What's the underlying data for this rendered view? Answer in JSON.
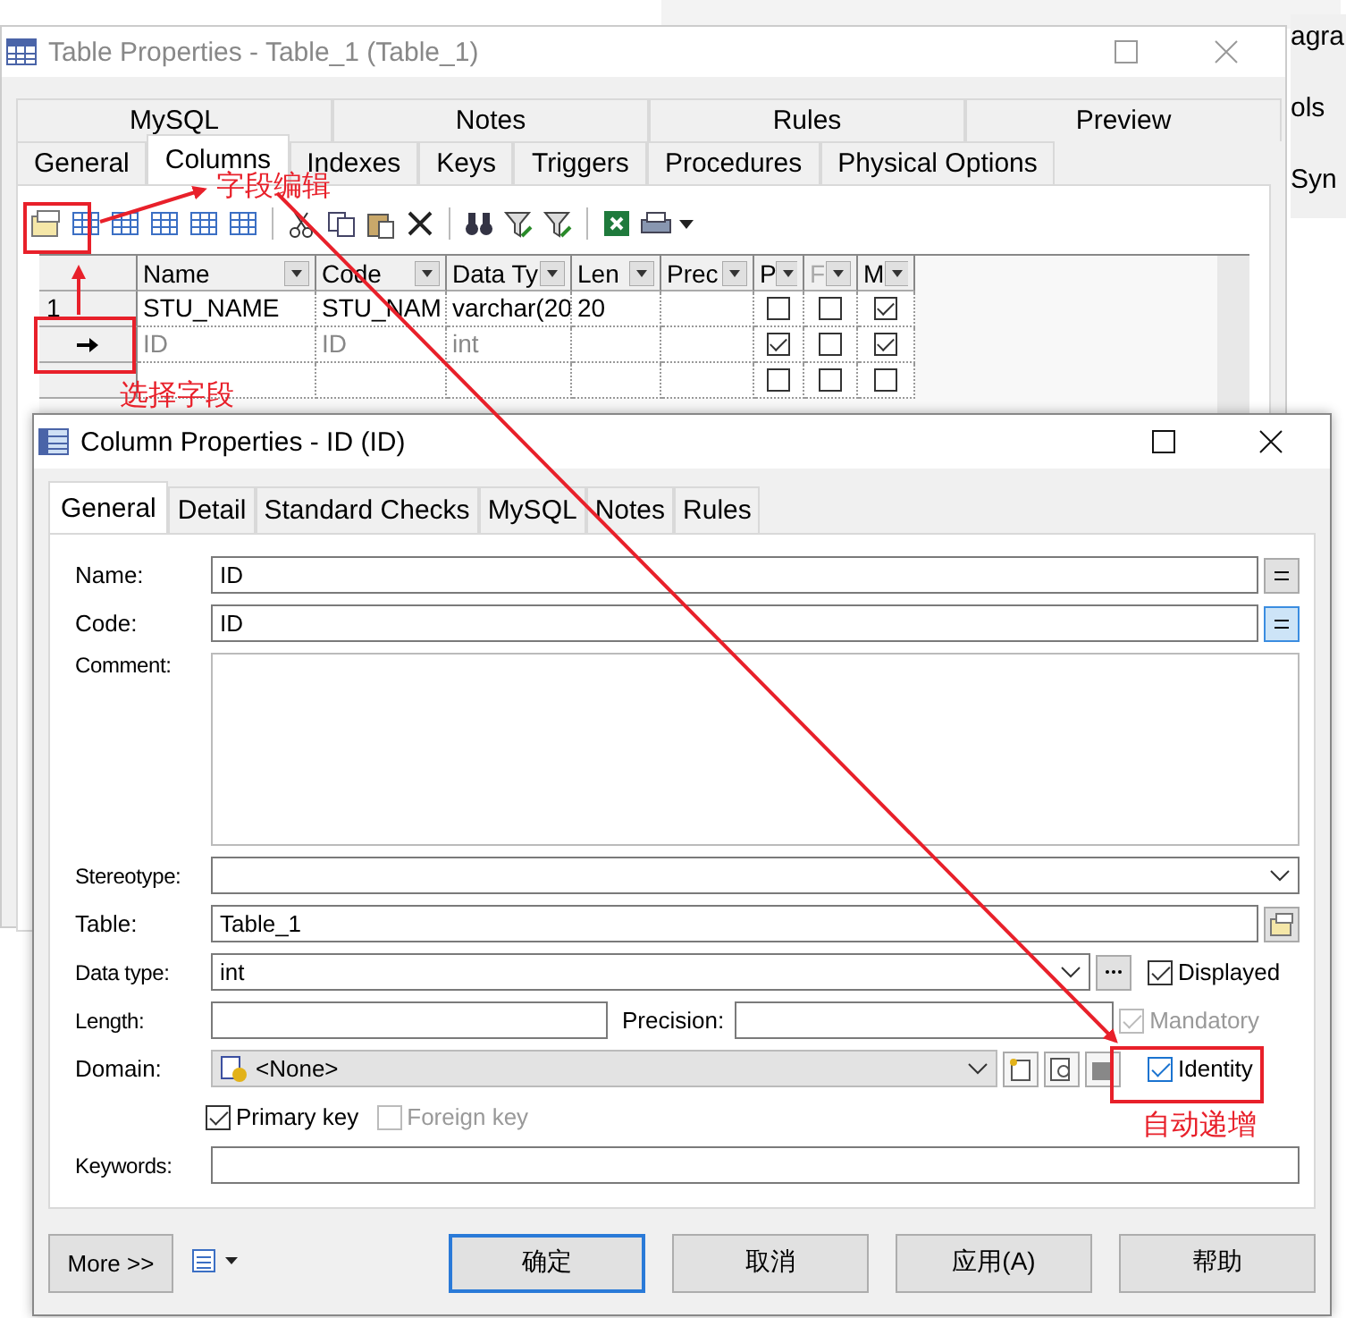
{
  "side_panel": {
    "texts": [
      "agra",
      "ols",
      "Syn"
    ]
  },
  "table_window": {
    "title": "Table Properties - Table_1 (Table_1)",
    "tabs_row_1": [
      {
        "label": "MySQL",
        "selected": false
      },
      {
        "label": "Notes",
        "selected": false
      },
      {
        "label": "Rules",
        "selected": false
      },
      {
        "label": "Preview",
        "selected": false
      }
    ],
    "tabs_row_2": [
      {
        "label": "General",
        "selected": false
      },
      {
        "label": "Columns",
        "selected": true
      },
      {
        "label": "Indexes",
        "selected": false
      },
      {
        "label": "Keys",
        "selected": false
      },
      {
        "label": "Triggers",
        "selected": false
      },
      {
        "label": "Procedures",
        "selected": false
      },
      {
        "label": "Physical Options",
        "selected": false
      }
    ],
    "grid": {
      "columns": [
        "Name",
        "Code",
        "Data Ty",
        "Len",
        "Prec",
        "P",
        "F",
        "M"
      ],
      "rows": [
        {
          "header": "1",
          "current": false,
          "name": "STU_NAME",
          "code": "STU_NAM",
          "data_type": "varchar(20",
          "length": "20",
          "p": false,
          "f": false,
          "m": true
        },
        {
          "current": true,
          "name": "ID",
          "code": "ID",
          "data_type": "int",
          "p": true,
          "f": false,
          "m": true
        },
        {
          "current": false,
          "p": false,
          "f": false,
          "m": false
        }
      ]
    }
  },
  "column_window": {
    "title": "Column Properties - ID (ID)",
    "tabs": [
      {
        "label": "General",
        "selected": true
      },
      {
        "label": "Detail",
        "selected": false
      },
      {
        "label": "Standard Checks",
        "selected": false
      },
      {
        "label": "MySQL",
        "selected": false
      },
      {
        "label": "Notes",
        "selected": false
      },
      {
        "label": "Rules",
        "selected": false
      }
    ],
    "name": {
      "label": "Name:",
      "value": "ID"
    },
    "code": {
      "label": "Code:",
      "value": "ID"
    },
    "comment": {
      "label": "Comment:"
    },
    "stereotype": {
      "label": "Stereotype:"
    },
    "table": {
      "label": "Table:",
      "value": "Table_1"
    },
    "data_type": {
      "label": "Data type:",
      "value": "int"
    },
    "length": {
      "label": "Length:"
    },
    "precision": {
      "label": "Precision:"
    },
    "domain": {
      "label": "Domain:",
      "value": "<None>"
    },
    "keywords": {
      "label": "Keywords:"
    },
    "displayed": {
      "label": "Displayed",
      "checked": true,
      "disabled": false
    },
    "mandatory": {
      "label": "Mandatory",
      "checked": true,
      "disabled": true
    },
    "identity": {
      "label": "Identity",
      "checked": true,
      "disabled": false
    },
    "primary_key": {
      "label": "Primary key",
      "checked": true,
      "disabled": false
    },
    "foreign_key": {
      "label": "Foreign key",
      "checked": false,
      "disabled": true
    },
    "more_button": "More >>",
    "buttons": [
      {
        "label": "确定",
        "default": true
      },
      {
        "label": "取消",
        "default": false
      },
      {
        "label": "应用(A)",
        "default": false
      },
      {
        "label": "帮助",
        "default": false
      }
    ]
  },
  "annotations": [
    "字段编辑",
    "选择字段",
    "自动递增"
  ]
}
